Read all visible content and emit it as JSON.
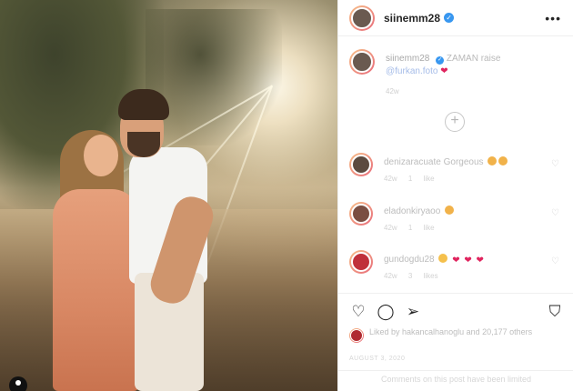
{
  "post": {
    "username": "siinemm28",
    "verified": "✓",
    "more": "•••"
  },
  "caption": {
    "username": "siinemm28",
    "text": "ZAMAN raise",
    "mention": "@furkan.foto",
    "heart": "❤",
    "time": "42w"
  },
  "load_more": "+",
  "comments": [
    {
      "username": "denizaracuate",
      "text": "Gorgeous",
      "emojis": [
        "😍",
        "😍"
      ],
      "time": "42w",
      "likes": "1 like"
    },
    {
      "username": "eladonkiryaoo",
      "text": "",
      "emojis": [
        "😍"
      ],
      "time": "42w",
      "likes": "1 like"
    },
    {
      "username": "gundogdu28",
      "text": "",
      "emojis": [
        "😊",
        "❤",
        "❤",
        "❤"
      ],
      "time": "42w",
      "likes": "3 likes"
    }
  ],
  "actions": {
    "like_icon": "heart-icon",
    "comment_icon": "comment-icon",
    "share_icon": "share-icon",
    "save_icon": "bookmark-icon"
  },
  "likes": {
    "text": "Liked by hakancalhanoglu and 20,177 others"
  },
  "post_date": "AUGUST 3, 2020",
  "comment_box": "Comments on this post have been limited"
}
